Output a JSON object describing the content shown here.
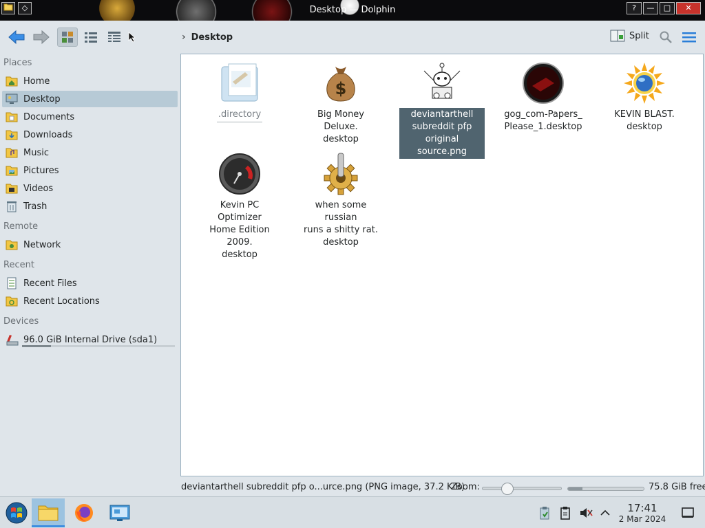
{
  "window": {
    "title": "Desktop — Dolphin",
    "help_label": "?",
    "minimize_label": "—",
    "maximize_label": "□",
    "close_label": "✕"
  },
  "toolbar": {
    "breadcrumb_current": "Desktop",
    "split_label": "Split"
  },
  "sidebar": {
    "places_label": "Places",
    "places": [
      {
        "label": "Home",
        "icon": "home-folder-icon"
      },
      {
        "label": "Desktop",
        "icon": "desktop-icon",
        "selected": true
      },
      {
        "label": "Documents",
        "icon": "documents-folder-icon"
      },
      {
        "label": "Downloads",
        "icon": "downloads-folder-icon"
      },
      {
        "label": "Music",
        "icon": "music-folder-icon"
      },
      {
        "label": "Pictures",
        "icon": "pictures-folder-icon"
      },
      {
        "label": "Videos",
        "icon": "videos-folder-icon"
      },
      {
        "label": "Trash",
        "icon": "trash-icon"
      }
    ],
    "remote_label": "Remote",
    "remote": [
      {
        "label": "Network",
        "icon": "network-folder-icon"
      }
    ],
    "recent_label": "Recent",
    "recent": [
      {
        "label": "Recent Files",
        "icon": "recent-files-icon"
      },
      {
        "label": "Recent Locations",
        "icon": "recent-locations-icon"
      }
    ],
    "devices_label": "Devices",
    "devices": [
      {
        "label": "96.0 GiB Internal Drive (sda1)",
        "icon": "hard-drive-icon",
        "usage_fraction": 0.19
      }
    ]
  },
  "files": [
    {
      "name": ".directory",
      "icon": "directory-file-icon",
      "dim": true
    },
    {
      "name": "Big Money Deluxe.\ndesktop",
      "icon": "money-bag-icon"
    },
    {
      "name": "deviantarthell\nsubreddit pfp\noriginal source.png",
      "icon": "reddit-image-icon",
      "selected": true
    },
    {
      "name": "gog_com-Papers_\nPlease_1.desktop",
      "icon": "papers-please-icon"
    },
    {
      "name": "KEVIN BLAST.\ndesktop",
      "icon": "sun-globe-icon"
    },
    {
      "name": "Kevin PC Optimizer\nHome Edition 2009.\ndesktop",
      "icon": "speedometer-icon"
    },
    {
      "name": "when some russian\nruns a shitty rat.\ndesktop",
      "icon": "gear-icon"
    }
  ],
  "statusbar": {
    "info": "deviantarthell subreddit pfp o...urce.png (PNG image, 37.2 KiB)",
    "zoom_label": "Zoom:",
    "zoom_fraction": 0.28,
    "disk_used_fraction": 0.19,
    "free_space": "75.8 GiB free"
  },
  "taskbar": {
    "clock_time": "17:41",
    "clock_date": "2 Mar 2024"
  },
  "colors": {
    "accent": "#3d8ee0",
    "selection": "#50646f",
    "sidebar_selection": "#b7cad6"
  }
}
